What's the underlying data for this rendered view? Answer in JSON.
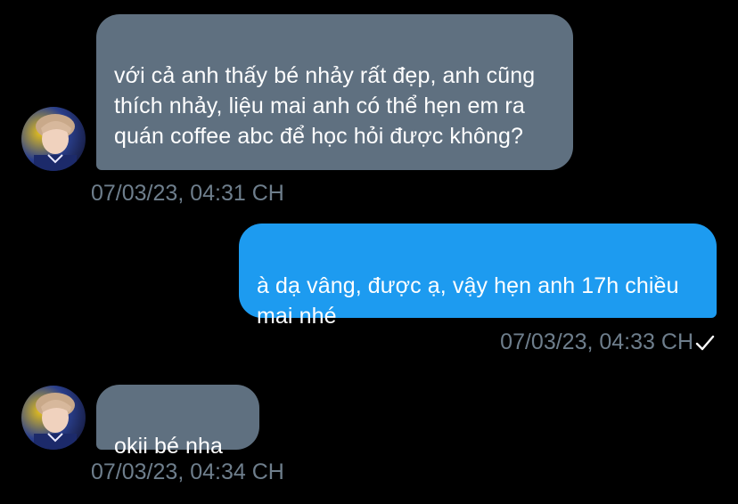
{
  "messages": [
    {
      "sender": "other",
      "text": "với cả anh thấy bé nhảy rất đẹp, anh cũng thích nhảy, liệu mai anh có thể hẹn em ra quán coffee abc để học hỏi được không?",
      "timestamp": "07/03/23, 04:31 CH"
    },
    {
      "sender": "me",
      "text": "à dạ vâng, được ạ, vậy hẹn anh 17h chiều mai nhé",
      "timestamp": "07/03/23, 04:33 CH",
      "status_icon": "check-icon"
    },
    {
      "sender": "other",
      "text": "okii bé nha",
      "timestamp": "07/03/23, 04:34 CH"
    }
  ],
  "colors": {
    "background": "#000000",
    "incoming_bubble": "#5f7080",
    "outgoing_bubble": "#1d9bf0",
    "timestamp": "#6e7e8c",
    "text": "#ffffff"
  },
  "icons": {
    "avatar": "user-avatar-photo",
    "sent_status": "check-icon"
  }
}
